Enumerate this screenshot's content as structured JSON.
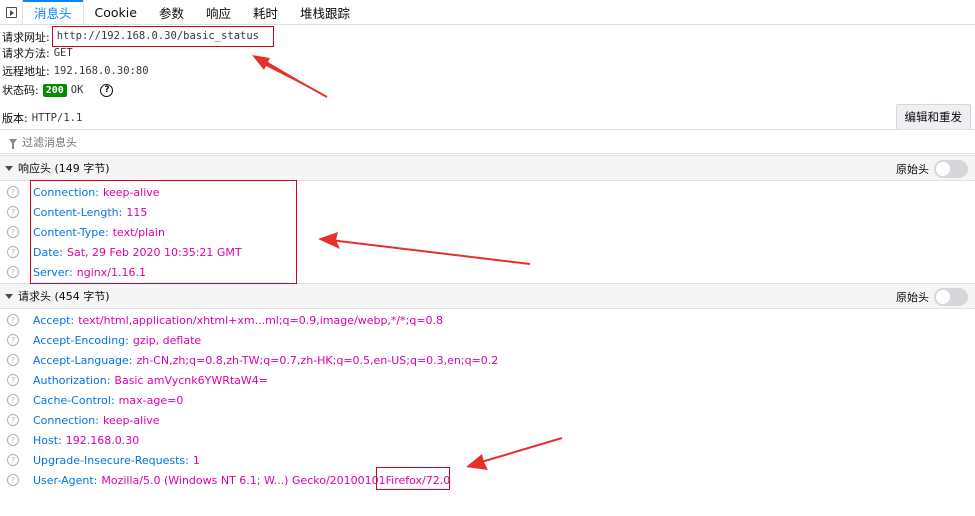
{
  "tabs": [
    {
      "label": "消息头",
      "active": true
    },
    {
      "label": "Cookie",
      "active": false
    },
    {
      "label": "参数",
      "active": false
    },
    {
      "label": "响应",
      "active": false
    },
    {
      "label": "耗时",
      "active": false
    },
    {
      "label": "堆栈跟踪",
      "active": false
    }
  ],
  "summary": {
    "request_url_label": "请求网址:",
    "request_url": "http://192.168.0.30/basic_status",
    "request_method_label": "请求方法:",
    "request_method": "GET",
    "remote_address_label": "远程地址:",
    "remote_address": "192.168.0.30:80",
    "status_code_label": "状态码:",
    "status_code": "200",
    "status_text": "OK",
    "version_label": "版本:",
    "version": "HTTP/1.1",
    "edit_resend_label": "编辑和重发"
  },
  "filter": {
    "placeholder": "过滤消息头"
  },
  "response_headers": {
    "title": "响应头 (149 字节)",
    "raw_label": "原始头",
    "items": [
      {
        "name": "Connection",
        "value": "keep-alive"
      },
      {
        "name": "Content-Length",
        "value": "115"
      },
      {
        "name": "Content-Type",
        "value": "text/plain"
      },
      {
        "name": "Date",
        "value": "Sat, 29 Feb 2020 10:35:21 GMT"
      },
      {
        "name": "Server",
        "value": "nginx/1.16.1"
      }
    ]
  },
  "request_headers": {
    "title": "请求头 (454 字节)",
    "raw_label": "原始头",
    "items": [
      {
        "name": "Accept",
        "value": "text/html,application/xhtml+xm...ml;q=0.9,image/webp,*/*;q=0.8"
      },
      {
        "name": "Accept-Encoding",
        "value": "gzip, deflate"
      },
      {
        "name": "Accept-Language",
        "value": "zh-CN,zh;q=0.8,zh-TW;q=0.7,zh-HK;q=0.5,en-US;q=0.3,en;q=0.2"
      },
      {
        "name": "Authorization",
        "value": "Basic amVycnk6YWRtaW4="
      },
      {
        "name": "Cache-Control",
        "value": "max-age=0"
      },
      {
        "name": "Connection",
        "value": "keep-alive"
      },
      {
        "name": "Host",
        "value": "192.168.0.30"
      },
      {
        "name": "Upgrade-Insecure-Requests",
        "value": "1"
      },
      {
        "name": "User-Agent",
        "value": "Mozilla/5.0 (Windows NT 6.1; W...) Gecko/20100101 ",
        "value_highlight": "Firefox/72.0"
      }
    ]
  },
  "colors": {
    "accent": "#0a84ff",
    "header_name": "#0074e8",
    "header_value": "#dd00a9",
    "status_ok": "#058b00",
    "annotation": "#d70022"
  }
}
